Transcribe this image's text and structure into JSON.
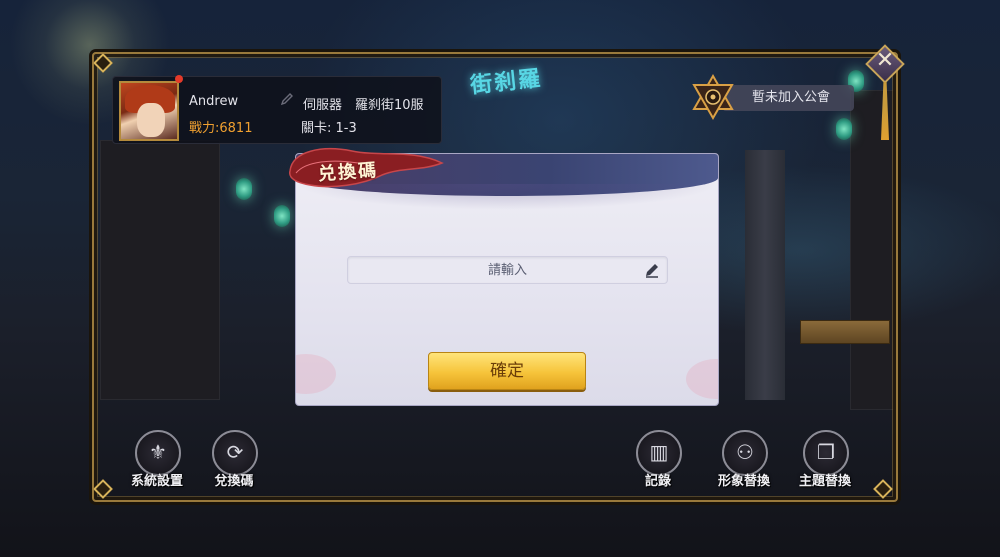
{
  "scene": {
    "neon_sign": "街刹羅"
  },
  "player": {
    "name": "Andrew",
    "power": "戰力:6811",
    "server_label": "伺服器",
    "server_name": "羅刹街10服",
    "stage": "關卡:  1-3",
    "avatar_icon": "avatar-portrait",
    "has_notification": true
  },
  "guild": {
    "status": "暫未加入公會",
    "emblem_icon": "hexagram-emblem-icon"
  },
  "dialog": {
    "title": "兑換碼",
    "input_placeholder": "請輸入",
    "input_value": "",
    "confirm_label": "確定"
  },
  "bottom_bar": {
    "left": [
      {
        "label": "系統設置",
        "icon": "system-settings-icon"
      },
      {
        "label": "兌換碼",
        "icon": "redeem-code-icon"
      }
    ],
    "right": [
      {
        "label": "記錄",
        "icon": "record-icon"
      },
      {
        "label": "形象替換",
        "icon": "avatar-swap-icon"
      },
      {
        "label": "主題替換",
        "icon": "theme-swap-icon"
      }
    ]
  },
  "colors": {
    "frame_gold": "#9a7a3c",
    "power_orange": "#f0a030",
    "confirm_gold": "#f6c43a",
    "neon_cyan": "#58d6e4"
  }
}
